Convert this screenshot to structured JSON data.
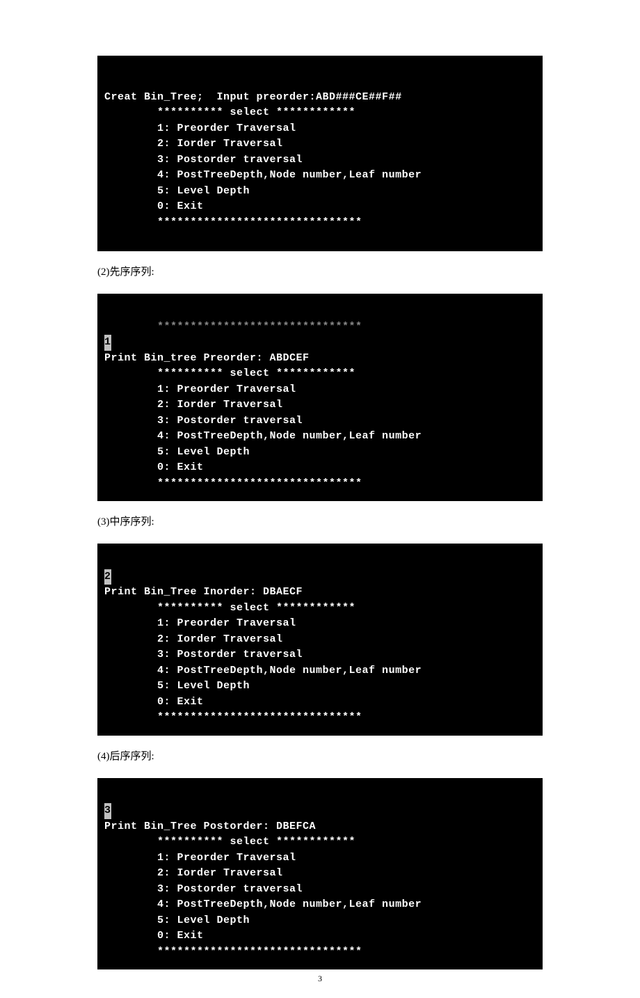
{
  "terminal1": {
    "lines": [
      "Creat Bin_Tree;  Input preorder:ABD###CE##F##",
      "        ********** select ************",
      "        1: Preorder Traversal",
      "        2: Iorder Traversal",
      "        3: Postorder traversal",
      "        4: PostTreeDepth,Node number,Leaf number",
      "        5: Level Depth",
      "        0: Exit",
      "        *******************************"
    ]
  },
  "caption2": "(2)先序序列:",
  "terminal2": {
    "fadedTop": "        *******************************",
    "cursor": "1",
    "lines": [
      "Print Bin_tree Preorder: ABDCEF",
      "        ********** select ************",
      "        1: Preorder Traversal",
      "        2: Iorder Traversal",
      "        3: Postorder traversal",
      "        4: PostTreeDepth,Node number,Leaf number",
      "        5: Level Depth",
      "        0: Exit",
      "        *******************************"
    ]
  },
  "caption3": "(3)中序序列:",
  "terminal3": {
    "cursor": "2",
    "lines": [
      "Print Bin_Tree Inorder: DBAECF",
      "        ********** select ************",
      "        1: Preorder Traversal",
      "        2: Iorder Traversal",
      "        3: Postorder traversal",
      "        4: PostTreeDepth,Node number,Leaf number",
      "        5: Level Depth",
      "        0: Exit",
      "        *******************************"
    ]
  },
  "caption4": "(4)后序序列:",
  "terminal4": {
    "cursor": "3",
    "lines": [
      "Print Bin_Tree Postorder: DBEFCA",
      "        ********** select ************",
      "        1: Preorder Traversal",
      "        2: Iorder Traversal",
      "        3: Postorder traversal",
      "        4: PostTreeDepth,Node number,Leaf number",
      "        5: Level Depth",
      "        0: Exit",
      "        *******************************"
    ]
  },
  "pageNumber": "3"
}
